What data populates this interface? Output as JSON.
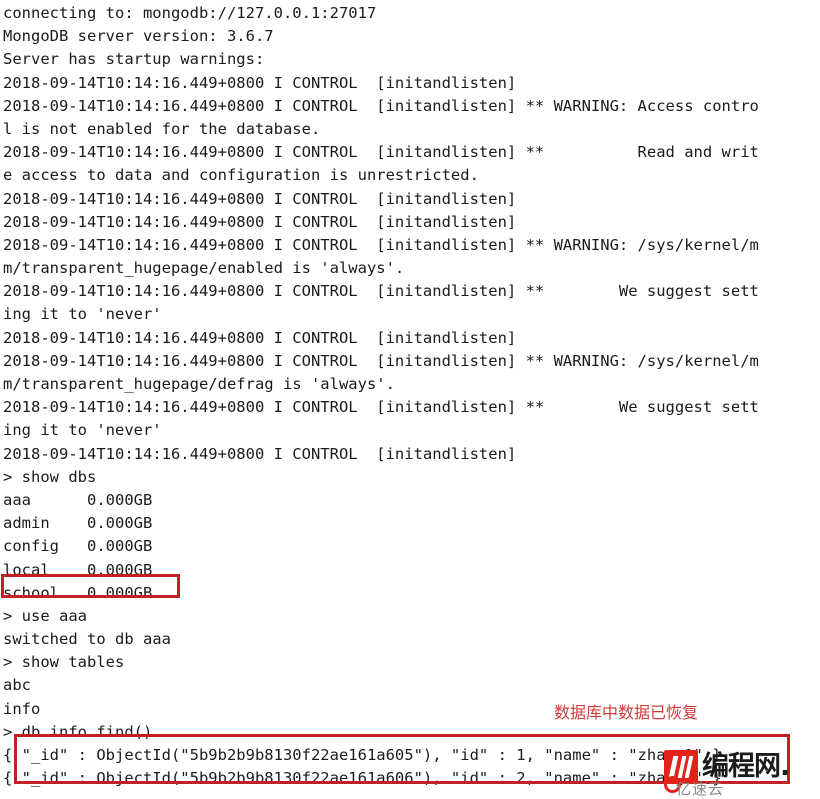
{
  "terminal": {
    "prompt": ">",
    "lines": [
      "connecting to: mongodb://127.0.0.1:27017",
      "MongoDB server version: 3.6.7",
      "Server has startup warnings:",
      "2018-09-14T10:14:16.449+0800 I CONTROL  [initandlisten]",
      "2018-09-14T10:14:16.449+0800 I CONTROL  [initandlisten] ** WARNING: Access contro",
      "l is not enabled for the database.",
      "2018-09-14T10:14:16.449+0800 I CONTROL  [initandlisten] **          Read and writ",
      "e access to data and configuration is unrestricted.",
      "2018-09-14T10:14:16.449+0800 I CONTROL  [initandlisten]",
      "2018-09-14T10:14:16.449+0800 I CONTROL  [initandlisten]",
      "2018-09-14T10:14:16.449+0800 I CONTROL  [initandlisten] ** WARNING: /sys/kernel/m",
      "m/transparent_hugepage/enabled is 'always'.",
      "2018-09-14T10:14:16.449+0800 I CONTROL  [initandlisten] **        We suggest sett",
      "ing it to 'never'",
      "2018-09-14T10:14:16.449+0800 I CONTROL  [initandlisten]",
      "2018-09-14T10:14:16.449+0800 I CONTROL  [initandlisten] ** WARNING: /sys/kernel/m",
      "m/transparent_hugepage/defrag is 'always'.",
      "2018-09-14T10:14:16.449+0800 I CONTROL  [initandlisten] **        We suggest sett",
      "ing it to 'never'",
      "2018-09-14T10:14:16.449+0800 I CONTROL  [initandlisten]",
      "> show dbs",
      "aaa      0.000GB",
      "admin    0.000GB",
      "config   0.000GB",
      "local    0.000GB",
      "school   0.000GB",
      "> use aaa",
      "switched to db aaa",
      "> show tables",
      "abc",
      "info",
      "> db.info.find()",
      "{ \"_id\" : ObjectId(\"5b9b2b9b8130f22ae161a605\"), \"id\" : 1, \"name\" : \"zhang1\" }",
      "{ \"_id\" : ObjectId(\"5b9b2b9b8130f22ae161a606\"), \"id\" : 2, \"name\" : \"zhang2\" }"
    ]
  },
  "annotations": {
    "note_text": "数据库中数据已恢复",
    "note_color": "#d13b3b",
    "box_color": "#c32025",
    "highlight_school_label": "school   0.000GB",
    "highlight_results_label": "db.info.find() result documents"
  },
  "watermark": {
    "logo_label": "编程网-logo",
    "brand": "编程网.",
    "sub_text": "亿速云"
  }
}
